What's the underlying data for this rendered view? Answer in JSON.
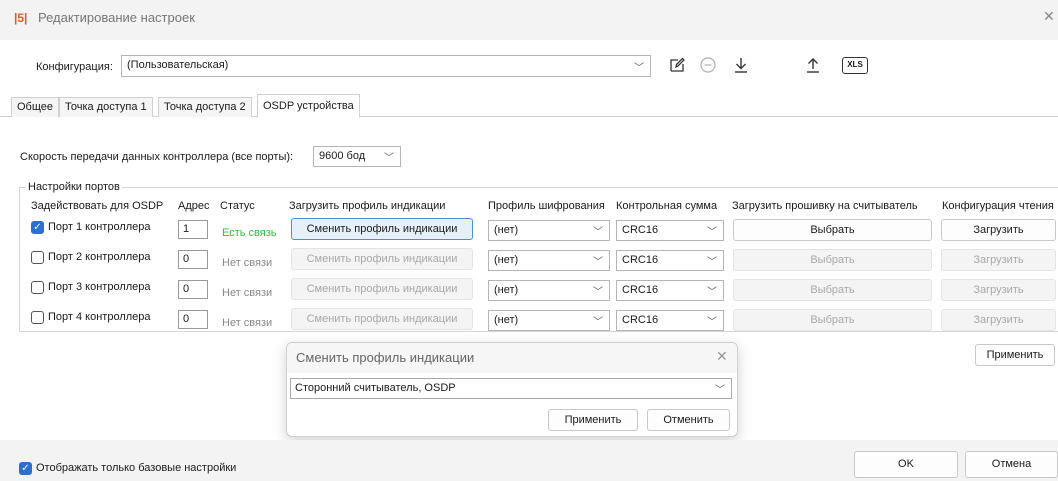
{
  "window": {
    "logo": "|5|",
    "title": "Редактирование настроек",
    "close_glyph": "✕"
  },
  "config": {
    "label": "Конфигурация:",
    "value": "(Пользовательская)",
    "toolbar_icons": [
      "edit-icon",
      "remove-icon",
      "download-icon",
      "upload-icon",
      "xls-export-icon"
    ],
    "xls_label": "XLS"
  },
  "tabs": [
    {
      "label": "Общее"
    },
    {
      "label": "Точка доступа 1"
    },
    {
      "label": "Точка доступа 2"
    },
    {
      "label": "OSDP устройства"
    }
  ],
  "active_tab": "OSDP устройства",
  "speed": {
    "label": "Скорость передачи данных контроллера (все порты):",
    "value": "9600 бод"
  },
  "ports_group": {
    "title": "Настройки портов",
    "headers": {
      "osdp": "Задействовать для OSDP",
      "address": "Адрес",
      "status": "Статус",
      "indication": "Загрузить профиль индикации",
      "encryption": "Профиль шифрования",
      "checksum": "Контрольная сумма",
      "firmware": "Загрузить прошивку на считыватель",
      "read_config": "Конфигурация чтения"
    },
    "rows": [
      {
        "enabled": true,
        "label": "Порт 1 контроллера",
        "address": "1",
        "status": "Есть связь",
        "indication_btn": "Сменить профиль индикации",
        "encryption": "(нет)",
        "checksum": "CRC16",
        "firmware_btn": "Выбрать",
        "config_btn": "Загрузить"
      },
      {
        "enabled": false,
        "label": "Порт 2 контроллера",
        "address": "0",
        "status": "Нет связи",
        "indication_btn": "Сменить профиль индикации",
        "encryption": "(нет)",
        "checksum": "CRC16",
        "firmware_btn": "Выбрать",
        "config_btn": "Загрузить"
      },
      {
        "enabled": false,
        "label": "Порт 3 контроллера",
        "address": "0",
        "status": "Нет связи",
        "indication_btn": "Сменить профиль индикации",
        "encryption": "(нет)",
        "checksum": "CRC16",
        "firmware_btn": "Выбрать",
        "config_btn": "Загрузить"
      },
      {
        "enabled": false,
        "label": "Порт 4 контроллера",
        "address": "0",
        "status": "Нет связи",
        "indication_btn": "Сменить профиль индикации",
        "encryption": "(нет)",
        "checksum": "CRC16",
        "firmware_btn": "Выбрать",
        "config_btn": "Загрузить"
      }
    ]
  },
  "apply_label": "Применить",
  "dialog": {
    "title": "Сменить профиль индикации",
    "close_glyph": "✕",
    "selected": "Сторонний считыватель, OSDP",
    "apply_label": "Применить",
    "cancel_label": "Отменить"
  },
  "footer": {
    "checkbox_label": "Отображать только базовые настройки",
    "checkbox_checked": true,
    "ok_label": "OK",
    "cancel_label": "Отмена"
  },
  "colors": {
    "accent": "#2b6fd3",
    "status_ok": "#2fbf3a",
    "status_off": "#888888",
    "logo": "#e05a24"
  }
}
